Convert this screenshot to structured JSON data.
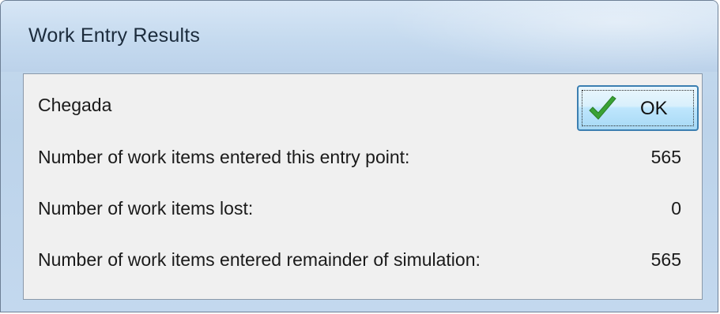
{
  "window": {
    "title": "Work Entry Results"
  },
  "content": {
    "entry_point_name": "Chegada",
    "rows": [
      {
        "label": "Number of work items entered this entry point:",
        "value": "565"
      },
      {
        "label": "Number of work items lost:",
        "value": "0"
      },
      {
        "label": "Number of work items entered remainder of simulation:",
        "value": "565"
      }
    ]
  },
  "buttons": {
    "ok_label": "OK",
    "ok_icon": "checkmark-icon"
  },
  "colors": {
    "checkmark": "#3aa235"
  }
}
